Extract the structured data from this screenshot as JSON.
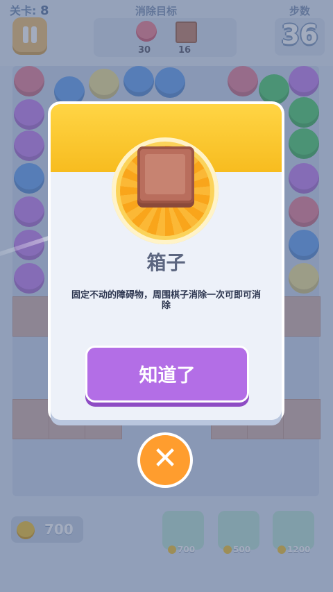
{
  "hud": {
    "level_label": "关卡:",
    "level_number": "8",
    "goals_title": "消除目标",
    "goal_ball_count": "30",
    "goal_crate_count": "16",
    "steps_label": "步数",
    "steps_value": "36"
  },
  "dialog": {
    "title": "箱子",
    "description": "固定不动的障碍物，周围棋子消除一次可即可消除",
    "confirm_label": "知道了"
  },
  "close_icon": "✕",
  "bottom": {
    "coins": "700",
    "items": [
      {
        "name": "potion",
        "price": "700"
      },
      {
        "name": "palette",
        "price": "500"
      },
      {
        "name": "balloons",
        "price": "1200"
      }
    ]
  },
  "colors": {
    "dialog_header": "#f7bc1f",
    "button_purple": "#b36ee6",
    "close_orange": "#ff9d2e"
  }
}
